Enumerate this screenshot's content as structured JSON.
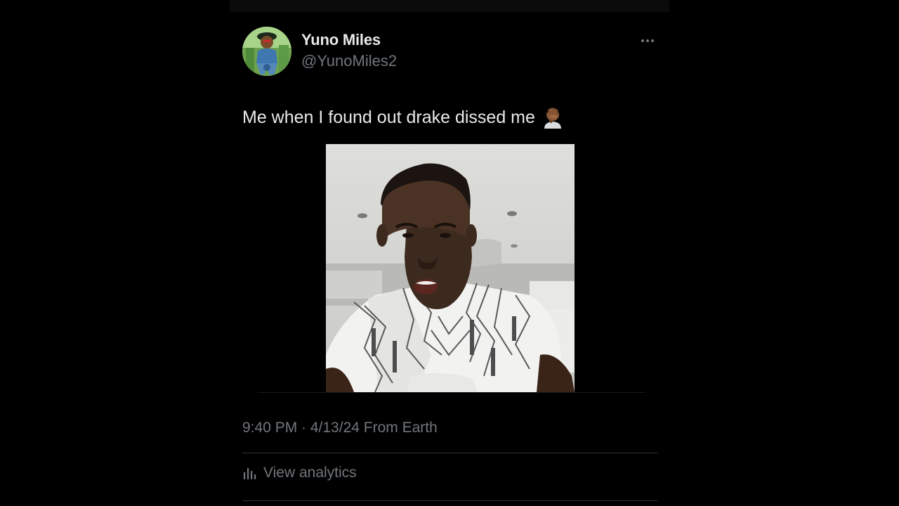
{
  "tweet": {
    "display_name": "Yuno Miles",
    "handle": "@YunoMiles2",
    "text": "Me when I found out drake dissed me",
    "emoji": "face-palm-emoji",
    "timestamp": "9:40 PM · 4/13/24 From Earth",
    "analytics_label": "View analytics"
  },
  "icons": {
    "more": "more-horizontal-icon",
    "analytics": "bar-chart-icon"
  },
  "colors": {
    "background": "#000000",
    "primary_text": "#e7e9ea",
    "secondary_text": "#71767b",
    "divider": "#2f3336"
  }
}
